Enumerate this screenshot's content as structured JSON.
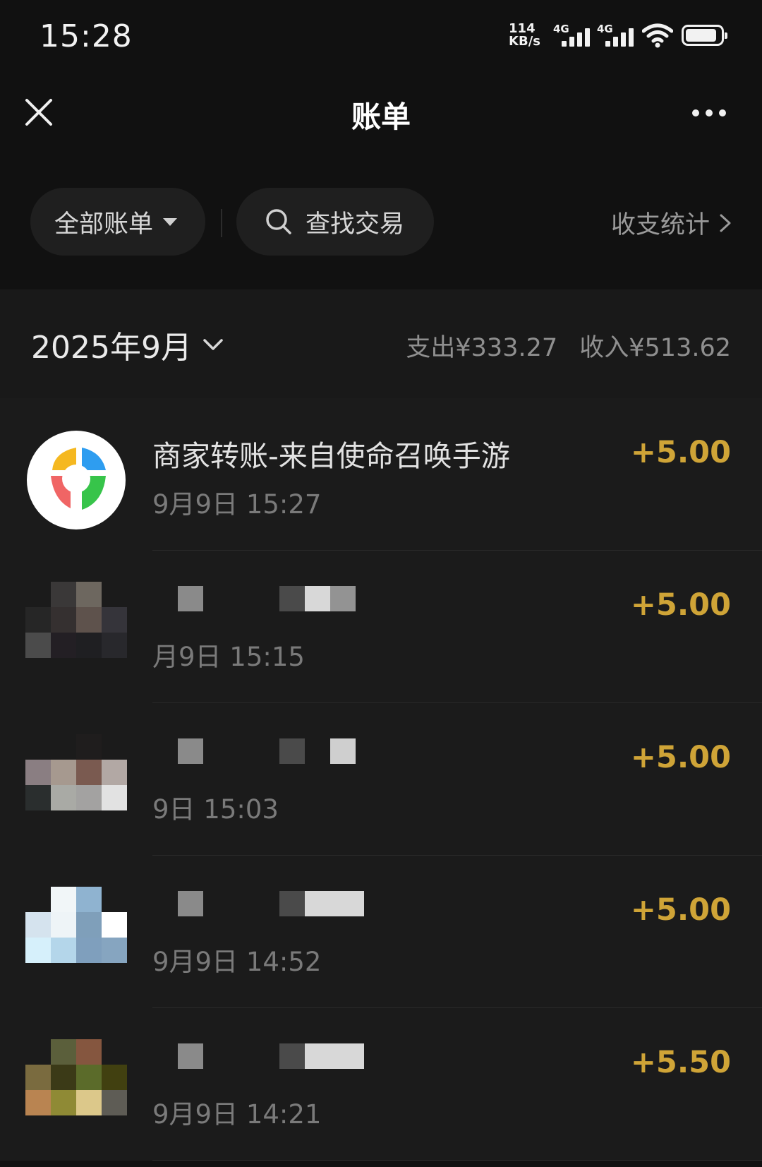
{
  "status_bar": {
    "time": "15:28",
    "net_speed_value": "114",
    "net_speed_unit": "KB/s",
    "signal_1_label": "4G",
    "signal_2_label": "4G",
    "icons": [
      "signal-icon",
      "wifi-icon",
      "battery-icon"
    ]
  },
  "header": {
    "title": "账单",
    "close_icon": "close-icon",
    "more_icon": "more-icon"
  },
  "filters": {
    "all_bills_label": "全部账单",
    "search_label": "查找交易",
    "stats_label": "收支统计"
  },
  "month": {
    "label": "2025年9月",
    "expense": "支出¥333.27",
    "income": "收入¥513.62"
  },
  "transactions": [
    {
      "title": "商家转账-来自使命召唤手游",
      "time": "9月9日 15:27",
      "amount": "+5.00"
    },
    {
      "title": "",
      "time": "月9日 15:15",
      "amount": "+5.00"
    },
    {
      "title": "",
      "time": "9日 15:03",
      "amount": "+5.00"
    },
    {
      "title": "",
      "time": "9月9日 14:52",
      "amount": "+5.00"
    },
    {
      "title": "",
      "time": "9月9日 14:21",
      "amount": "+5.50"
    }
  ],
  "colors": {
    "background": "#111111",
    "amount": "#cfa437",
    "muted": "#7a7a7a"
  }
}
